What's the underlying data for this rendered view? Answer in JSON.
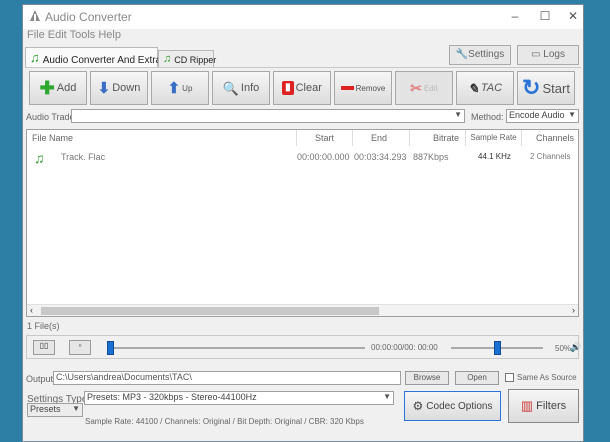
{
  "window": {
    "title": "Audio Converter",
    "controls": {
      "minimize": "–",
      "maximize": "☐",
      "close": "✕"
    }
  },
  "menu": {
    "label": "File Edit Tools Help"
  },
  "tabs": [
    {
      "label": "Audio Converter And Extractor",
      "active": true
    },
    {
      "label": "CD Ripper",
      "active": false
    }
  ],
  "top_buttons": {
    "settings": "Settings",
    "logs": "Logs"
  },
  "toolbar": {
    "add": "Add",
    "down": "Down",
    "up": "Up",
    "info": "Info",
    "clear": "Clear",
    "remove": "Remove",
    "edit": "Edit",
    "tac": "TAC",
    "start": "Start"
  },
  "audio_trade": {
    "label": "Audio Trade:",
    "value": ""
  },
  "method": {
    "label": "Method:",
    "value": "Encode Audio"
  },
  "table": {
    "columns": [
      "File Name",
      "Start",
      "End",
      "Bitrate",
      "Sample Rate",
      "Channels"
    ],
    "rows": [
      {
        "name": "Track. Flac",
        "start": "00:00:00.000",
        "end": "00:03:34.293",
        "bitrate": "887Kbps",
        "sample_rate": "44.1 KHz",
        "channels": "2 Channels"
      }
    ]
  },
  "status": {
    "files_count": "1 File(s)"
  },
  "player": {
    "time": "00:00:00/00: 00:00",
    "volume": "50%",
    "volume_value": 50,
    "position_value": 0
  },
  "output": {
    "label": "Output:",
    "path": "C:\\Users\\andrea\\Documents\\TAC\\",
    "browse": "Browse",
    "open": "Open",
    "same_as_source": "Same As Source",
    "same_as_source_checked": false
  },
  "settings_type": {
    "label": "Settings Type:",
    "preset_value": "Presets: MP3 - 320kbps - Stereo-44100Hz",
    "presets_selector": "Presets"
  },
  "codec_options": "Codec Options",
  "filters": "Filters",
  "summary": "Sample Rate: 44100 / Channels: Original / Bit Depth: Original / CBR: 320 Kbps"
}
